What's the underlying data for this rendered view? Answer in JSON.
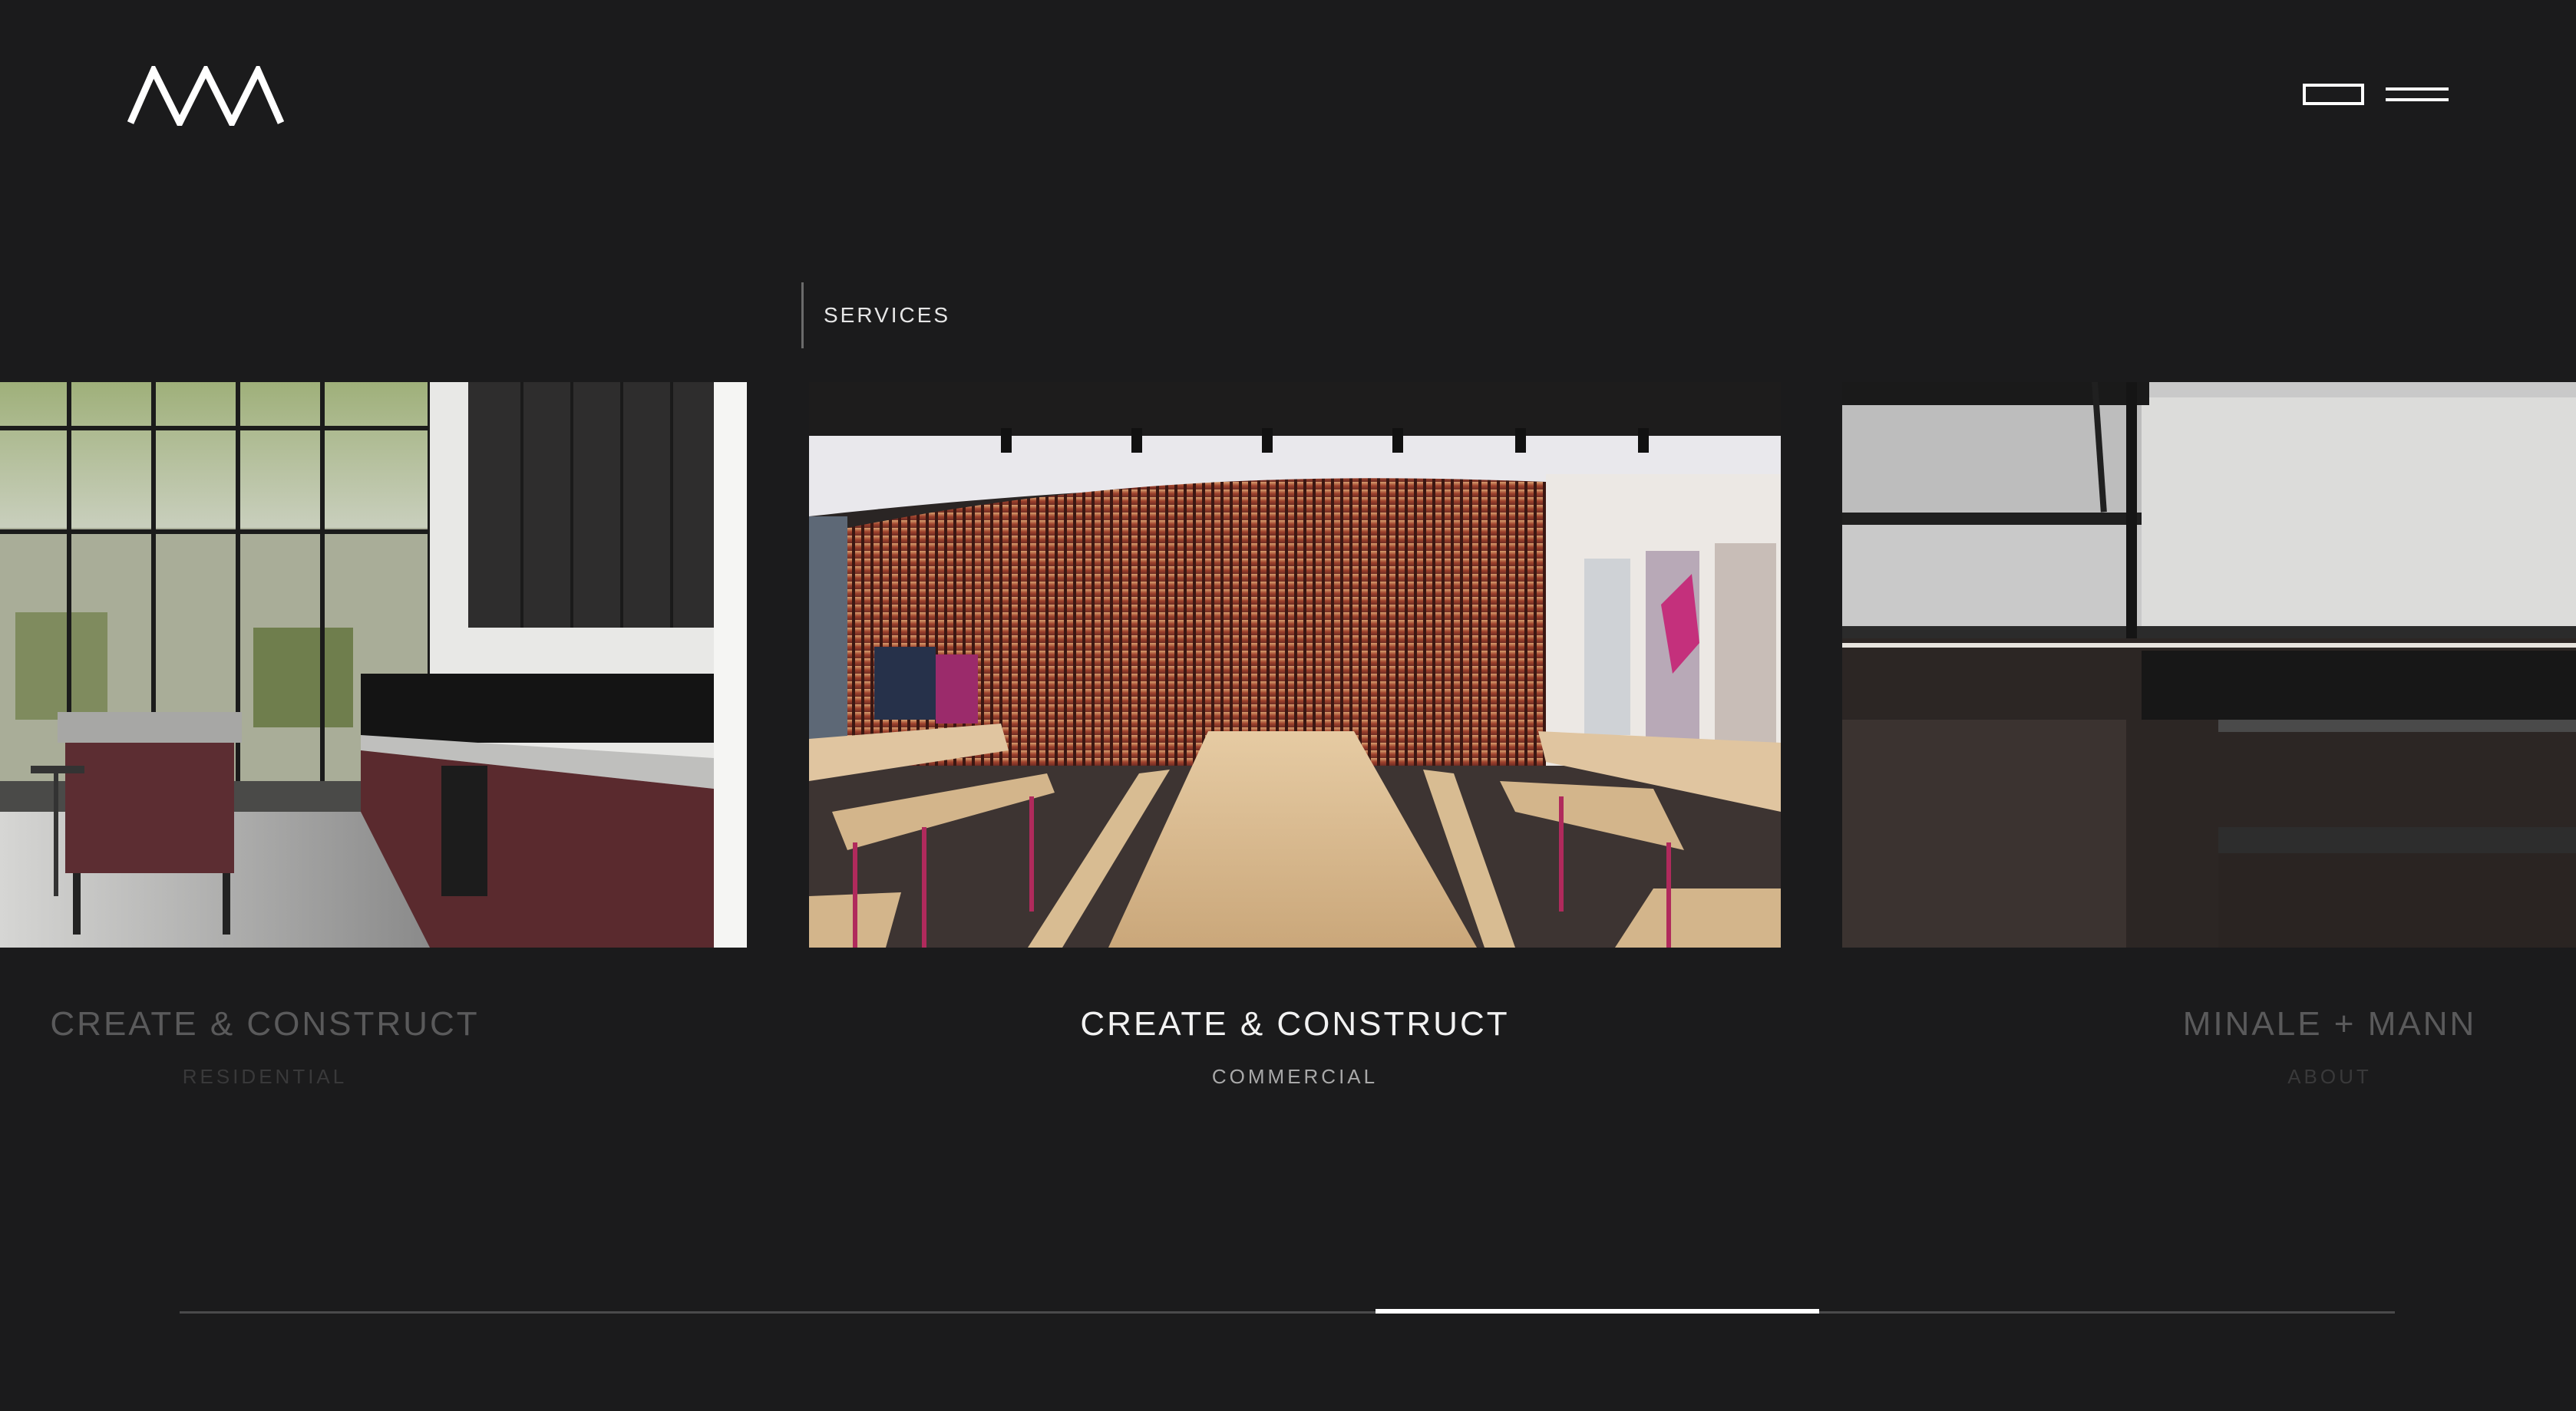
{
  "header": {
    "logo_alt": "MM",
    "view_toggle": "gallery-view-icon",
    "menu": "hamburger-menu-icon"
  },
  "section": {
    "label": "SERVICES"
  },
  "slides": [
    {
      "title": "CREATE & CONSTRUCT",
      "subtitle": "RESIDENTIAL",
      "image": "kitchen-photo"
    },
    {
      "title": "CREATE & CONSTRUCT",
      "subtitle": "COMMERCIAL",
      "image": "canteen-photo"
    },
    {
      "title": "MINALE + MANN",
      "subtitle": "ABOUT",
      "image": "office-detail-photo"
    }
  ],
  "progress": {
    "position": 0.64,
    "size": 0.2
  },
  "colors": {
    "background": "#1b1b1c",
    "foreground": "#ffffff"
  }
}
